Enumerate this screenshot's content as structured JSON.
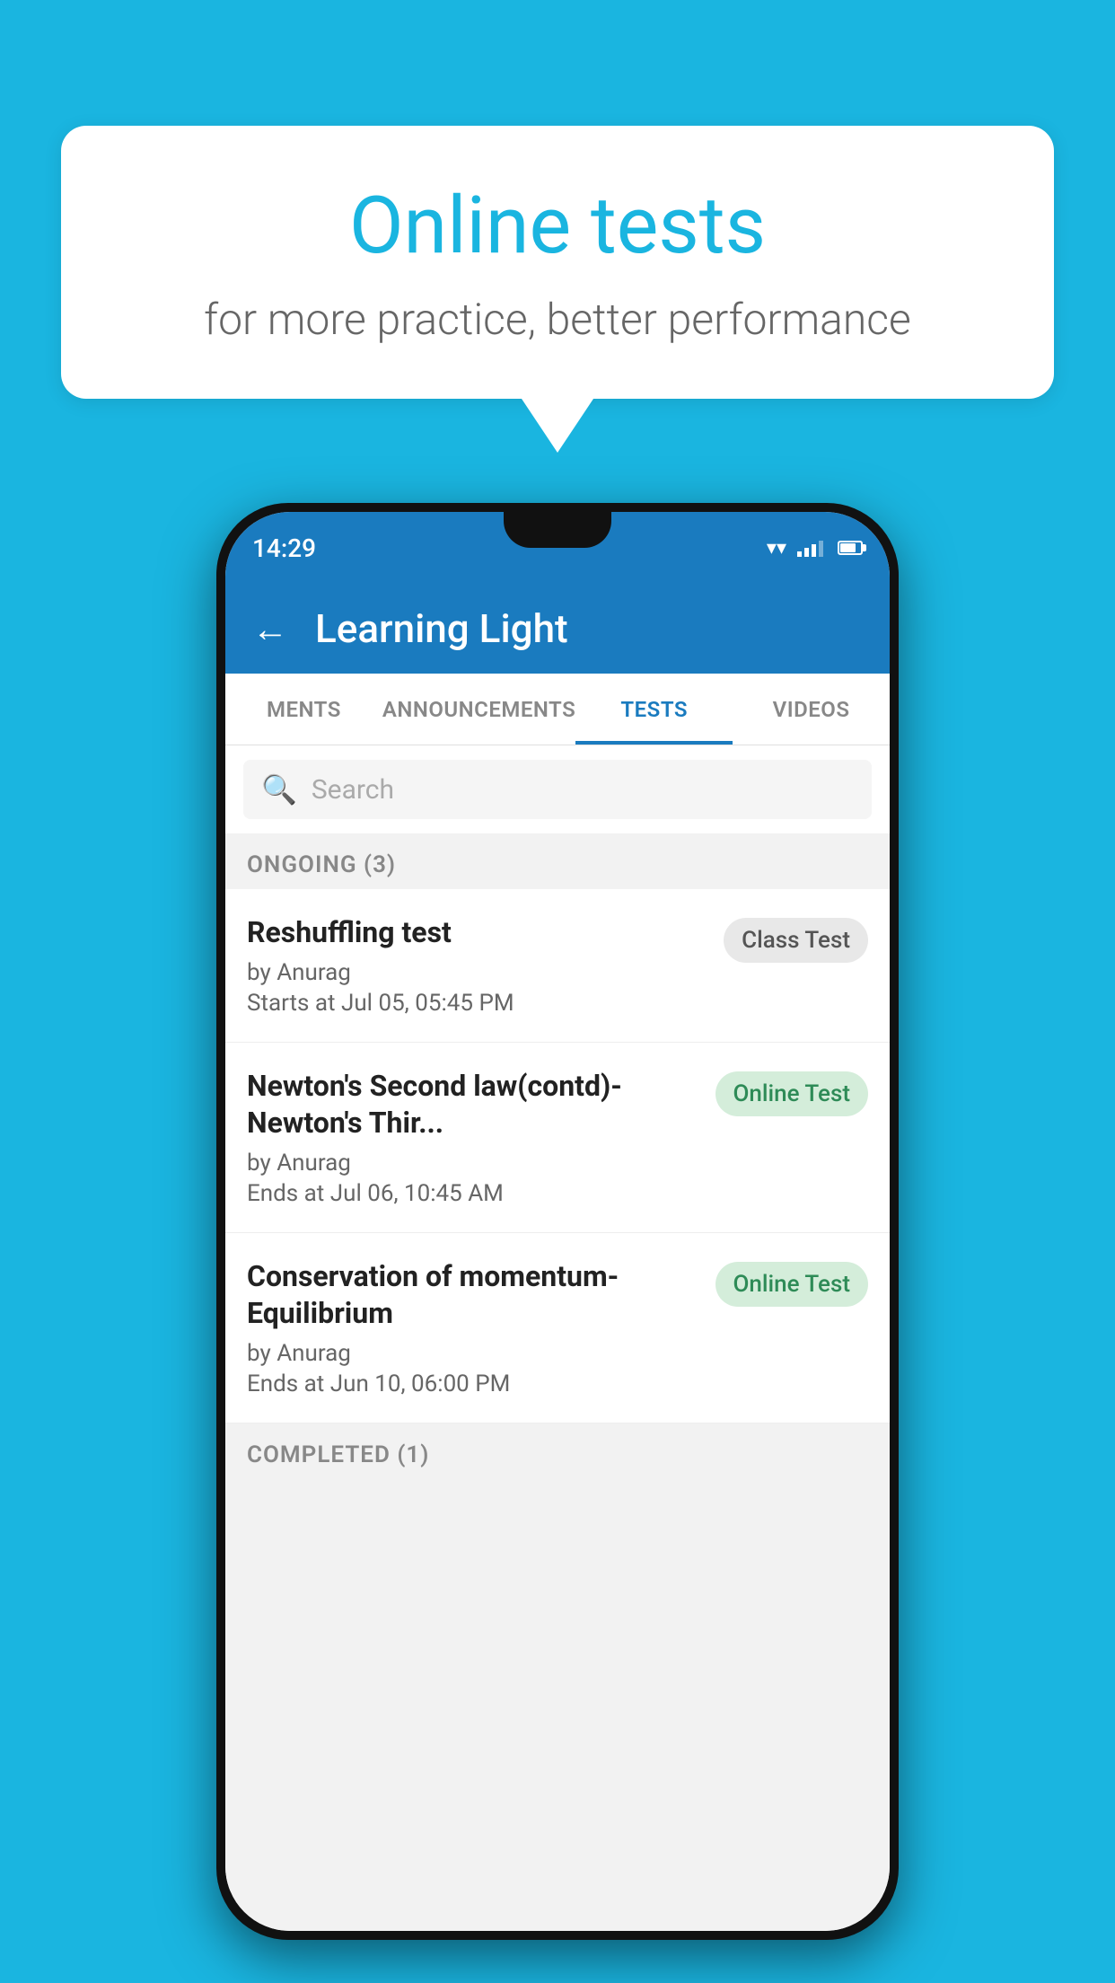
{
  "background_color": "#1ab5e0",
  "speech_bubble": {
    "title": "Online tests",
    "subtitle": "for more practice, better performance"
  },
  "phone": {
    "status_bar": {
      "time": "14:29",
      "wifi": true,
      "signal": true,
      "battery": true
    },
    "app_header": {
      "back_label": "←",
      "title": "Learning Light"
    },
    "tabs": [
      {
        "label": "MENTS",
        "active": false
      },
      {
        "label": "ANNOUNCEMENTS",
        "active": false
      },
      {
        "label": "TESTS",
        "active": true
      },
      {
        "label": "VIDEOS",
        "active": false
      }
    ],
    "search": {
      "placeholder": "Search"
    },
    "ongoing_section": {
      "title": "ONGOING (3)",
      "tests": [
        {
          "name": "Reshuffling test",
          "author": "by Anurag",
          "time": "Starts at  Jul 05, 05:45 PM",
          "badge": "Class Test",
          "badge_type": "class"
        },
        {
          "name": "Newton's Second law(contd)-Newton's Thir...",
          "author": "by Anurag",
          "time": "Ends at  Jul 06, 10:45 AM",
          "badge": "Online Test",
          "badge_type": "online"
        },
        {
          "name": "Conservation of momentum-Equilibrium",
          "author": "by Anurag",
          "time": "Ends at  Jun 10, 06:00 PM",
          "badge": "Online Test",
          "badge_type": "online"
        }
      ]
    },
    "completed_section": {
      "title": "COMPLETED (1)"
    }
  }
}
